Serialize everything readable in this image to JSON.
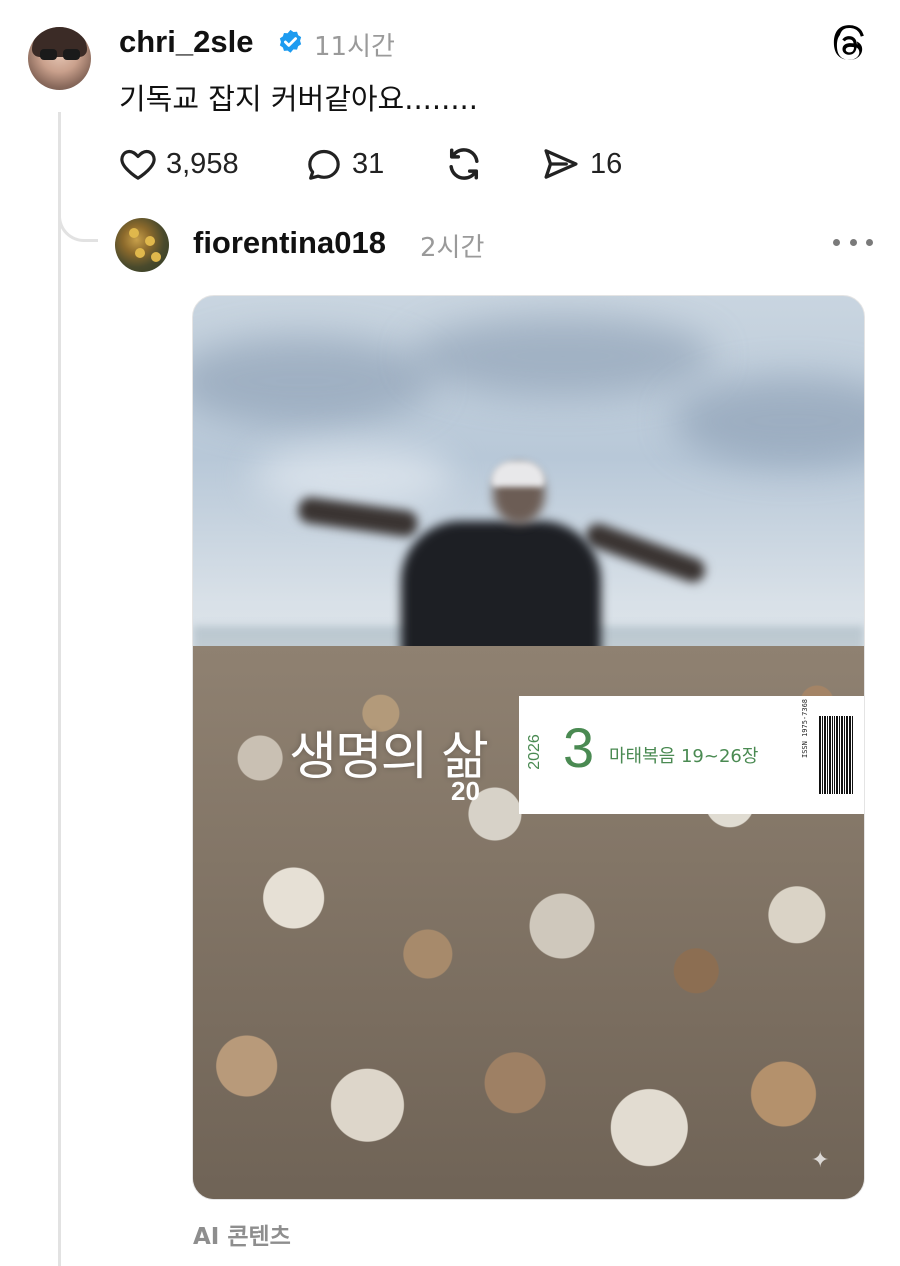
{
  "post": {
    "username": "chri_2sle",
    "time": "11시간",
    "text": "기독교 잡지 커버같아요........",
    "likes": "3,958",
    "comments": "31",
    "shares": "16"
  },
  "reply": {
    "username": "fiorentina018",
    "time": "2시간",
    "cover": {
      "title": "생명의 삶",
      "volume": "20",
      "year": "2026",
      "month": "3",
      "passage": "마태복음 19~26장",
      "isbn": "ISSN 1975-7368"
    },
    "content_tag": "AI 콘텐츠"
  },
  "icons": {
    "app_logo": "threads-logo-icon",
    "verified": "verified-badge-icon",
    "like": "heart-icon",
    "comment": "comment-bubble-icon",
    "repost": "repost-icon",
    "share": "send-icon",
    "more": "more-options-icon"
  },
  "colors": {
    "verified": "#1d9bf0",
    "cover_accent": "#4a8a52"
  }
}
